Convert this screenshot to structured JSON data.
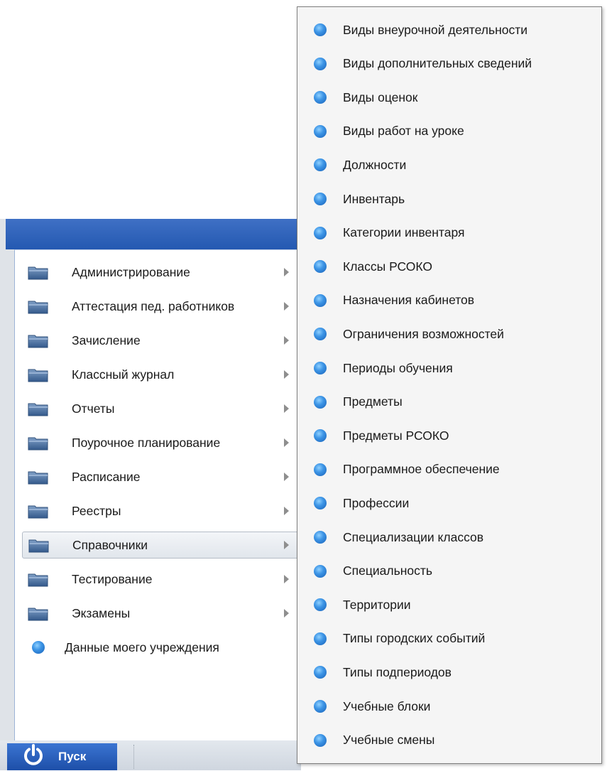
{
  "start_menu": {
    "items": [
      {
        "label": "Администрирование",
        "icon": "folder-icon",
        "has_submenu": true,
        "selected": false
      },
      {
        "label": "Аттестация пед. работников",
        "icon": "folder-icon",
        "has_submenu": true,
        "selected": false
      },
      {
        "label": "Зачисление",
        "icon": "folder-icon",
        "has_submenu": true,
        "selected": false
      },
      {
        "label": "Классный журнал",
        "icon": "folder-icon",
        "has_submenu": true,
        "selected": false
      },
      {
        "label": "Отчеты",
        "icon": "folder-icon",
        "has_submenu": true,
        "selected": false
      },
      {
        "label": "Поурочное планирование",
        "icon": "folder-icon",
        "has_submenu": true,
        "selected": false
      },
      {
        "label": "Расписание",
        "icon": "folder-icon",
        "has_submenu": true,
        "selected": false
      },
      {
        "label": "Реестры",
        "icon": "folder-icon",
        "has_submenu": true,
        "selected": false
      },
      {
        "label": "Справочники",
        "icon": "folder-icon",
        "has_submenu": true,
        "selected": true
      },
      {
        "label": "Тестирование",
        "icon": "folder-icon",
        "has_submenu": true,
        "selected": false
      },
      {
        "label": "Экзамены",
        "icon": "folder-icon",
        "has_submenu": true,
        "selected": false
      },
      {
        "label": "Данные моего учреждения",
        "icon": "blue-dot-icon",
        "has_submenu": false,
        "selected": false
      }
    ]
  },
  "taskbar": {
    "start_label": "Пуск",
    "start_icon": "power-icon"
  },
  "submenu": {
    "items": [
      "Виды внеурочной деятельности",
      "Виды дополнительных сведений",
      "Виды оценок",
      "Виды работ на уроке",
      "Должности",
      "Инвентарь",
      "Категории инвентаря",
      "Классы РСОКО",
      "Назначения кабинетов",
      "Ограничения возможностей",
      "Периоды обучения",
      "Предметы",
      "Предметы РСОКО",
      "Программное обеспечение",
      "Профессии",
      "Специализации классов",
      "Специальность",
      "Территории",
      "Типы городских событий",
      "Типы подпериодов",
      "Учебные блоки",
      "Учебные смены"
    ],
    "item_icon": "blue-dot-icon"
  },
  "colors": {
    "header_blue": "#2d5fb6",
    "start_button_blue": "#2a5fbf",
    "dot_blue": "#3d95e6"
  }
}
